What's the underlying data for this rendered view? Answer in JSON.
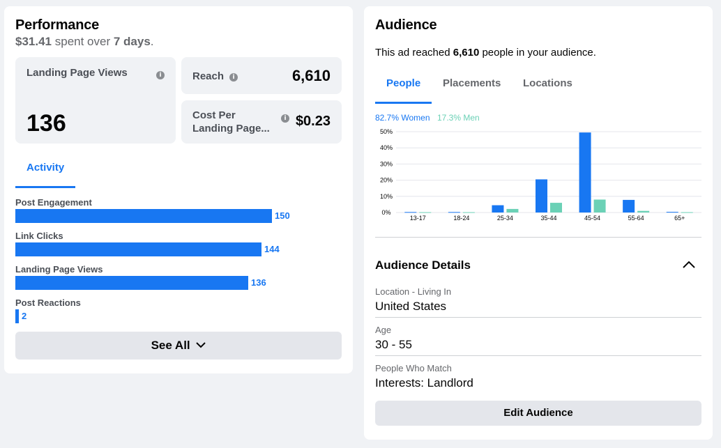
{
  "performance": {
    "title": "Performance",
    "spent_amount": "$31.41",
    "spent_middle": "spent over",
    "spent_days": "7 days",
    "spent_end": ".",
    "landing_page_views": {
      "label": "Landing Page Views",
      "value": "136"
    },
    "reach": {
      "label": "Reach",
      "value": "6,610"
    },
    "cost_per": {
      "label_line1": "Cost Per",
      "label_line2": "Landing Page...",
      "value": "$0.23"
    },
    "activity_tab": "Activity",
    "activities": [
      {
        "label": "Post Engagement",
        "value": 150
      },
      {
        "label": "Link Clicks",
        "value": 144
      },
      {
        "label": "Landing Page Views",
        "value": 136
      },
      {
        "label": "Post Reactions",
        "value": 2
      }
    ],
    "see_all": "See All"
  },
  "audience": {
    "title": "Audience",
    "reach_prefix": "This ad reached",
    "reach_count": "6,610",
    "reach_suffix": "people in your audience.",
    "tabs": [
      "People",
      "Placements",
      "Locations"
    ],
    "active_tab": "People",
    "legend": {
      "women": "82.7% Women",
      "men": "17.3% Men"
    },
    "details_title": "Audience Details",
    "details": [
      {
        "label": "Location - Living In",
        "value": "United States"
      },
      {
        "label": "Age",
        "value": "30 - 55"
      },
      {
        "label": "People Who Match",
        "value": "Interests: Landlord"
      }
    ],
    "edit_button": "Edit Audience"
  },
  "colors": {
    "accent": "#1877f2",
    "men": "#6bd1b6",
    "bg": "#f0f2f5"
  },
  "chart_data": {
    "type": "bar",
    "categories": [
      "13-17",
      "18-24",
      "25-34",
      "35-44",
      "45-54",
      "55-64",
      "65+"
    ],
    "series": [
      {
        "name": "82.7% Women",
        "values": [
          0.3,
          0.3,
          4.5,
          20.5,
          49.5,
          7.8,
          0.4
        ]
      },
      {
        "name": "17.3% Men",
        "values": [
          0.2,
          0.2,
          2.2,
          6,
          8,
          1,
          0.2
        ]
      }
    ],
    "ylim": [
      0,
      50
    ],
    "yticks": [
      "0%",
      "10%",
      "20%",
      "30%",
      "40%",
      "50%"
    ],
    "grid": true
  }
}
